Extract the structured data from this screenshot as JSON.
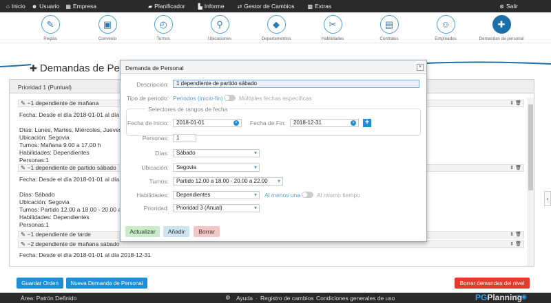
{
  "topnav": {
    "left": [
      {
        "icon": "home-icon",
        "label": "Inicio"
      },
      {
        "icon": "user-icon",
        "label": "Usuario"
      },
      {
        "icon": "building-icon",
        "label": "Empresa"
      }
    ],
    "center": [
      {
        "icon": "car-icon",
        "label": "Planificador"
      },
      {
        "icon": "chart-icon",
        "label": "Informe"
      },
      {
        "icon": "exchange-icon",
        "label": "Gestor de Cambios"
      },
      {
        "icon": "cubes-icon",
        "label": "Extras"
      }
    ],
    "exit": "Salir"
  },
  "iconbar": [
    {
      "label": "Reglas",
      "glyph": "✎"
    },
    {
      "label": "Convenio",
      "glyph": "▣"
    },
    {
      "label": "Turnos",
      "glyph": "◴"
    },
    {
      "label": "Ubicaciones",
      "glyph": "⚲"
    },
    {
      "label": "Departamentos",
      "glyph": "◆"
    },
    {
      "label": "Habilidades",
      "glyph": "✂"
    },
    {
      "label": "Contratos",
      "glyph": "▤"
    },
    {
      "label": "Empleados",
      "glyph": "☺"
    },
    {
      "label": "Demandas de personal",
      "glyph": "✚"
    }
  ],
  "page": {
    "title": "Demandas de Pers",
    "priority": "Prioridad 1 (Puntual)"
  },
  "rules": [
    {
      "title": "−1 dependiente de mañana",
      "lines": [
        "Fecha: Desde el día 2018-01-01 al día 20",
        "",
        "Días: Lunes, Martes, Miércoles, Jueves, Vi",
        "Ubicación: Segovia",
        "Turnos: Mañana 9.00 a 17.00 h",
        "Habilidades: Dependientes",
        "Personas:1"
      ]
    },
    {
      "title": "−1 dependiente de partido sábado",
      "lines": [
        "Fecha: Desde el día 2018-01-01 al día 20",
        "",
        "Días: Sábado",
        "Ubicación: Segovia",
        "Turnos: Partido 12.00 a 18.00 - 20.00 a 2",
        "Habilidades: Dependientes",
        "Personas:1"
      ]
    },
    {
      "title": "−1 dependiente de tarde",
      "lines": []
    },
    {
      "title": "−2 dependiente de mañana sábado",
      "lines": [
        "Fecha: Desde el día 2018-01-01 al día 2018-12-31"
      ]
    }
  ],
  "buttons": {
    "save": "Guardar Orden",
    "new": "Nueva Demanda de Personal",
    "delete_all": "Borrar demandas del nivel"
  },
  "footer": {
    "area": "Área: Patrón Definido",
    "help": "Ayuda",
    "log": "Registro de cambios",
    "terms": "Condiciones generales de uso",
    "brand_pg": "PG",
    "brand_rest": "Planning"
  },
  "modal": {
    "title": "Demanda de Personal",
    "close": "×",
    "desc_label": "Descripción:",
    "desc_value": "1 dependiente de partido sábado",
    "type_label": "Tipo de periodo:",
    "type_a": "Periodos (inicio-fin)",
    "type_b": "Múltiples fechas específicas",
    "range_legend": "Selectores de rangos de fecha",
    "start_label": "Fecha de Inicio:",
    "start_value": "2018-01-01",
    "end_label": "Fecha de Fin:",
    "end_value": "2018-12-31",
    "persons_label": "Personas:",
    "persons_value": "1",
    "days_label": "Días:",
    "days_value": "Sábado",
    "loc_label": "Ubicación:",
    "loc_value": "Segovia",
    "shifts_label": "Turnos:",
    "shifts_value": "Partido 12.00 a 18.00 - 20.00 a 22.00",
    "skills_label": "Habilidades:",
    "skills_value": "Dependientes",
    "atleast": "Al menos una",
    "sametime": "Al mismo tiempo",
    "prio_label": "Prioridad:",
    "prio_value": "Prioridad 3 (Anual)",
    "update": "Actualizar",
    "add": "Añadir",
    "delete": "Borrar"
  },
  "colors": {
    "accent": "#1c6fa8",
    "update": "#c9ecc9",
    "add": "#cfe4f3",
    "delete": "#f3c7c7",
    "red": "#e53b2c"
  }
}
